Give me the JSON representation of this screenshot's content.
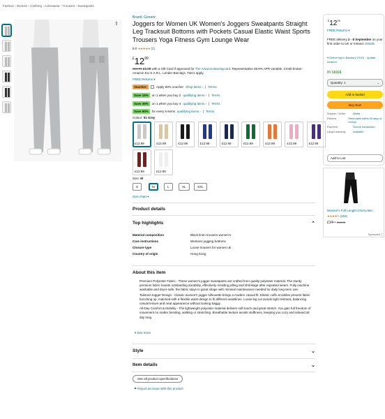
{
  "breadcrumb": "Fashion › Women › Clothing › Activewear › Trousers › Sweatpants",
  "brand": "Brand: Generic",
  "title": "Joggers for Women UK Women's Joggers Sweatpants Straight Leg Tracksuit Bottoms with Pockets Casual Elastic Waist Sports Trousers Yoga Fitness Gym Lounge Wear",
  "rating": {
    "value": "5.0",
    "stars": "★★★★★",
    "count": "(2)"
  },
  "price": {
    "symbol": "£",
    "whole": "12",
    "fraction": "99"
  },
  "gift_card": {
    "was": "£12.99",
    "now": "£0.00",
    "text": " with a Gift Card if approved for ",
    "link": "The Amazon Barclaycard",
    "rest": ". Representative 28.9% APR variable. Credit broker: Amazon EU S.A.R.L. Lender Barclays. T&Cs apply."
  },
  "free_returns": "FREE Returns",
  "voucher": {
    "badge": "Voucher:",
    "text": "Apply 50% voucher",
    "shop": "Shop items ›",
    "terms": "Terms"
  },
  "promos": [
    {
      "badge": "Save 15%",
      "text": "on 1 when you buy 2",
      "link": "qualifying items ›",
      "terms": "Terms"
    },
    {
      "badge": "Save 35%",
      "text": "on 1 when you buy 4",
      "link": "qualifying items ›",
      "terms": "Terms"
    },
    {
      "badge": "Save 50%",
      "text": "for every 6 items",
      "link": "qualifying items ›",
      "terms": "Terms"
    }
  ],
  "colour": {
    "label": "Colour: ",
    "value": "01 Grey"
  },
  "swatches": [
    {
      "price": "£12.99",
      "color": "#c9c9c9"
    },
    {
      "price": "£12.99",
      "color": "#d8c7a6"
    },
    {
      "price": "£12.99",
      "color": "#1a1a1a"
    },
    {
      "price": "£12.99",
      "color": "#1f3a8a"
    },
    {
      "price": "£12.99",
      "color": "#1b2a4a"
    },
    {
      "price": "£12.99",
      "color": "#0f6b3a"
    },
    {
      "price": "£12.99",
      "color": "#e2783a"
    },
    {
      "price": "£12.99",
      "color": "#f2a9c2"
    },
    {
      "price": "£12.99",
      "color": "#4b2a8a"
    },
    {
      "price": "£12.99",
      "color": "#7a1d1d"
    },
    {
      "price": "£12.99",
      "color": "#efefef"
    }
  ],
  "size": {
    "label": "Size: ",
    "value": "M",
    "options": [
      "S",
      "M",
      "L",
      "XL",
      "XXL"
    ]
  },
  "size_chart": "Size chart ▾",
  "product_details": "Product details",
  "top_highlights": "Top highlights",
  "highlights": [
    {
      "k": "Material composition",
      "v": "Black linen trousers women's"
    },
    {
      "k": "Care instructions",
      "v": "Womens jogging bottoms"
    },
    {
      "k": "Closure type",
      "v": "Loose trousers for women uk"
    },
    {
      "k": "Country of origin",
      "v": "Hong Kong"
    }
  ],
  "about_title": "About this item",
  "about": [
    "Premium Polyester Fabric - These women's jogger sweatpants are crafted from quality polyester material. The sturdy premium fabric boasts outstanding durability, effectively resisting pilling and shrinkage after repeated wears. Fully machine washable and dryer-safe, the fabric stays in great shape with minimal maintenance needed for daily long-term use.",
    "Tailored Jogger Design - Classic women's jogger silhouette brings a modern casual fit. Elastic cuffs at ankles prevent fabric bunching up, matched with a flexible waist design to fit different waistlines. Loose leg cut avoids tight restraint, balancing casual leisure and neat appearance without looking baggy.",
    "All-Day Comfort & Mobility - The lightweight polyester material delivers soft touch and great stretch. You gain full freedom of movement no matter bending, walking or stretching. Breathable texture avoids stuffiness, keeping you cozy and relaxed all day long."
  ],
  "see_more": "See more",
  "style": "Style",
  "item_details": "Item details",
  "see_all_specs": "See all product specifications",
  "report": "Report an issue with this product",
  "buybox": {
    "price_whole": "12",
    "price_fraction": "99",
    "symbol": "£",
    "free_returns": "FREE Returns",
    "delivery_pre": "FREE delivery ",
    "delivery_date": "2 - 8 September",
    "delivery_post": " on your first order to UK or Ireland. ",
    "details": "Details",
    "deliver_to": "Delivering to Banbury OX16 - Update location",
    "stock": "In stock",
    "qty": "Quantity: 1",
    "add": "Add to basket",
    "buy": "Buy Now",
    "table": [
      {
        "k": "Shipper / Seller",
        "v": "Allstar"
      },
      {
        "k": "Returns",
        "v": "Returnable within 30 days of receipt"
      },
      {
        "k": "Payment",
        "v": "Secure transaction"
      },
      {
        "k": "Larger warranty",
        "v": "Available"
      }
    ],
    "add_list": "Add to List"
  },
  "ad": {
    "title": "Women's Full Length Cherry Ber...",
    "stars": "★★★★½",
    "count": "(304)",
    "price": "£14⁹⁹",
    "was": "£16.99",
    "sponsored": "Sponsored ⓘ"
  },
  "colors": {
    "link": "#007185",
    "yellow": "#ffd814",
    "orange": "#ffa41c",
    "green": "#007600"
  }
}
